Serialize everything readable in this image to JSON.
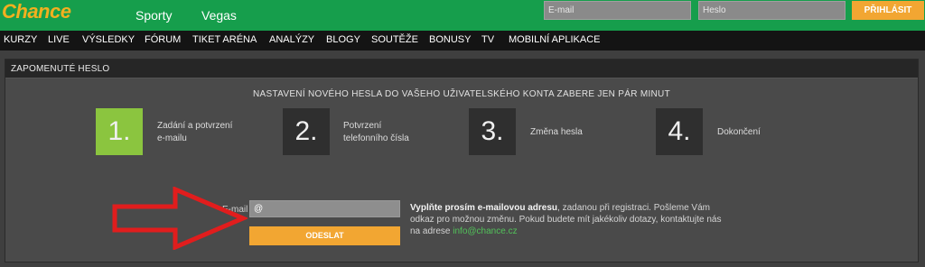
{
  "header": {
    "logo": "Chance",
    "nav": [
      "Sporty",
      "Vegas"
    ],
    "email_placeholder": "E-mail",
    "password_placeholder": "Heslo",
    "login_label": "PŘIHLÁSIT"
  },
  "main_nav": [
    "KURZY",
    "LIVE",
    "VÝSLEDKY",
    "FÓRUM",
    "TIKET ARÉNA",
    "ANALÝZY",
    "BLOGY",
    "SOUTĚŽE",
    "BONUSY",
    "TV",
    "MOBILNÍ APLIKACE"
  ],
  "panel": {
    "title": "ZAPOMENUTÉ HESLO",
    "subtitle": "NASTAVENÍ NOVÉHO HESLA DO VAŠEHO UŽIVATELSKÉHO KONTA ZABERE JEN PÁR MINUT",
    "steps": [
      {
        "number": "1.",
        "line1": "Zadání a potvrzení",
        "line2": "e-mailu",
        "active": true
      },
      {
        "number": "2.",
        "line1": "Potvrzení",
        "line2": "telefonního čísla",
        "active": false
      },
      {
        "number": "3.",
        "line1": "Změna hesla",
        "line2": "",
        "active": false
      },
      {
        "number": "4.",
        "line1": "Dokončení",
        "line2": "",
        "active": false
      }
    ],
    "email_label": "E-mail",
    "email_value": "@",
    "send_label": "ODESLAT",
    "info_bold": "Vyplňte prosím e-mailovou adresu",
    "info_text": ", zadanou při registraci. Pošleme Vám odkaz pro možnou změnu. Pokud budete mít jakékoliv dotazy, kontaktujte nás na adrese ",
    "info_email": "info@chance.cz"
  },
  "colors": {
    "brand_green": "#169e4c",
    "accent_orange": "#f2a632",
    "step_active": "#8bc53f",
    "step_inactive": "#2f2f2f",
    "arrow_red": "#e11d1d"
  }
}
